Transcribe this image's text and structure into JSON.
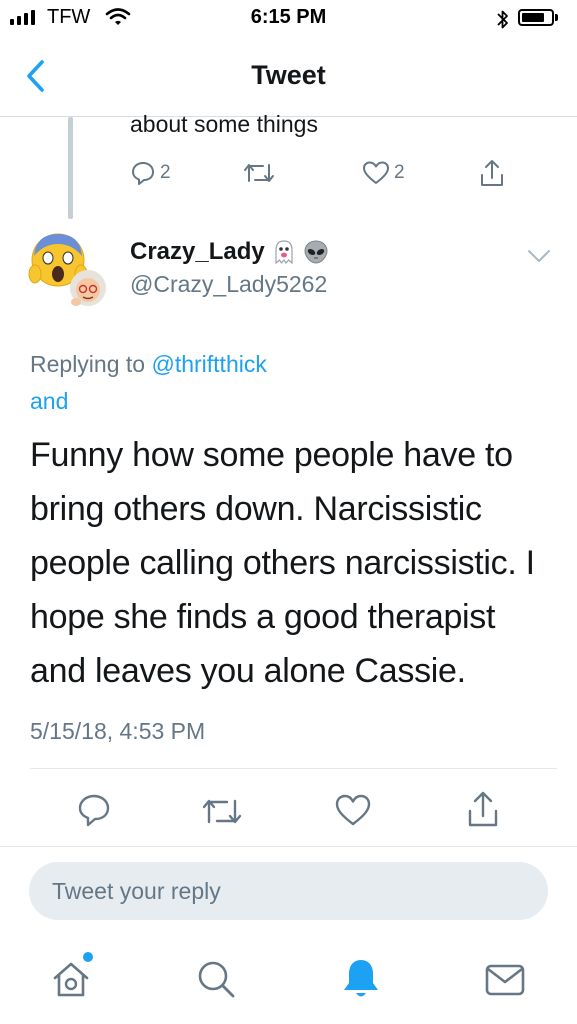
{
  "status_bar": {
    "carrier": "TFW",
    "time": "6:15 PM",
    "bluetooth": "✱"
  },
  "nav": {
    "title": "Tweet",
    "back_icon": "chevron-left-icon"
  },
  "previous_tweet": {
    "text_fragment": "about some things",
    "reply_count": "2",
    "like_count": "2"
  },
  "tweet": {
    "author_name": "Crazy_Lady",
    "author_emojis": [
      "ghost-emoji",
      "alien-emoji"
    ],
    "author_handle": "@Crazy_Lady5262",
    "replying_prefix": "Replying to",
    "replying_handle": "@thriftthick",
    "replying_more": "and",
    "text": "Funny how some people have to bring others down. Narcissistic people calling others narcissistic. I hope she finds a good therapist and leaves you alone Cassie.",
    "timestamp": "5/15/18, 4:53 PM"
  },
  "compose": {
    "placeholder": "Tweet your reply"
  },
  "tab_bar": {
    "items": [
      "home",
      "search",
      "notifications",
      "messages"
    ],
    "active": "notifications"
  },
  "colors": {
    "accent": "#1da1f2",
    "secondary_text": "#657786",
    "primary_text": "#14171a",
    "compose_bg": "#e6ecf0"
  }
}
